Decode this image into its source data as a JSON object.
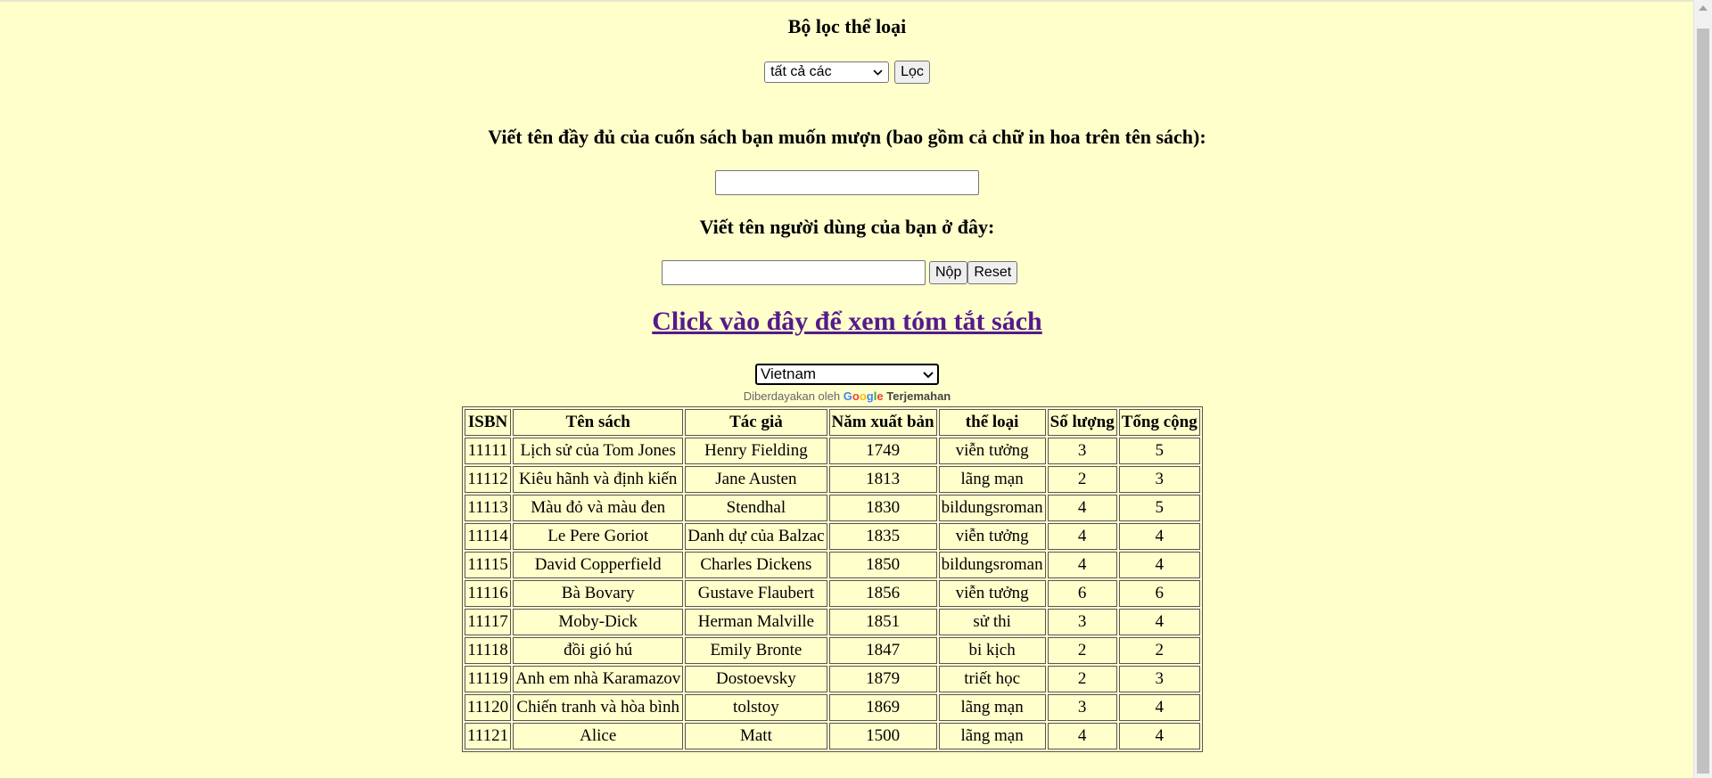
{
  "filter": {
    "heading": "Bộ lọc thể loại",
    "selected_genre": "tất cả các",
    "filter_button": "Lọc"
  },
  "borrow": {
    "book_heading": "Viết tên đầy đủ của cuốn sách bạn muốn mượn (bao gồm cả chữ in hoa trên tên sách):",
    "user_heading": "Viết tên người dùng của bạn ở đây:",
    "submit_button": "Nộp",
    "reset_button": "Reset"
  },
  "summary_link": "Click vào đây để xem tóm tắt sách",
  "translate": {
    "selected_language": "Vietnam",
    "powered_prefix": "Diberdayakan oleh",
    "google": "Google",
    "translate_label": "Terjemahan"
  },
  "table": {
    "headers": [
      "ISBN",
      "Tên sách",
      "Tác giả",
      "Năm xuất bản",
      "thể loại",
      "Số lượng",
      "Tổng cộng"
    ],
    "rows": [
      [
        "11111",
        "Lịch sử của Tom Jones",
        "Henry Fielding",
        "1749",
        "viễn tưởng",
        "3",
        "5"
      ],
      [
        "11112",
        "Kiêu hãnh và định kiến",
        "Jane Austen",
        "1813",
        "lãng mạn",
        "2",
        "3"
      ],
      [
        "11113",
        "Màu đỏ và màu đen",
        "Stendhal",
        "1830",
        "bildungsroman",
        "4",
        "5"
      ],
      [
        "11114",
        "Le Pere Goriot",
        "Danh dự của Balzac",
        "1835",
        "viễn tưởng",
        "4",
        "4"
      ],
      [
        "11115",
        "David Copperfield",
        "Charles Dickens",
        "1850",
        "bildungsroman",
        "4",
        "4"
      ],
      [
        "11116",
        "Bà Bovary",
        "Gustave Flaubert",
        "1856",
        "viễn tưởng",
        "6",
        "6"
      ],
      [
        "11117",
        "Moby-Dick",
        "Herman Malville",
        "1851",
        "sử thi",
        "3",
        "4"
      ],
      [
        "11118",
        "đồi gió hú",
        "Emily Bronte",
        "1847",
        "bi kịch",
        "2",
        "2"
      ],
      [
        "11119",
        "Anh em nhà Karamazov",
        "Dostoevsky",
        "1879",
        "triết học",
        "2",
        "3"
      ],
      [
        "11120",
        "Chiến tranh và hòa bình",
        "tolstoy",
        "1869",
        "lãng mạn",
        "3",
        "4"
      ],
      [
        "11121",
        "Alice",
        "Matt",
        "1500",
        "lãng mạn",
        "4",
        "4"
      ]
    ]
  }
}
